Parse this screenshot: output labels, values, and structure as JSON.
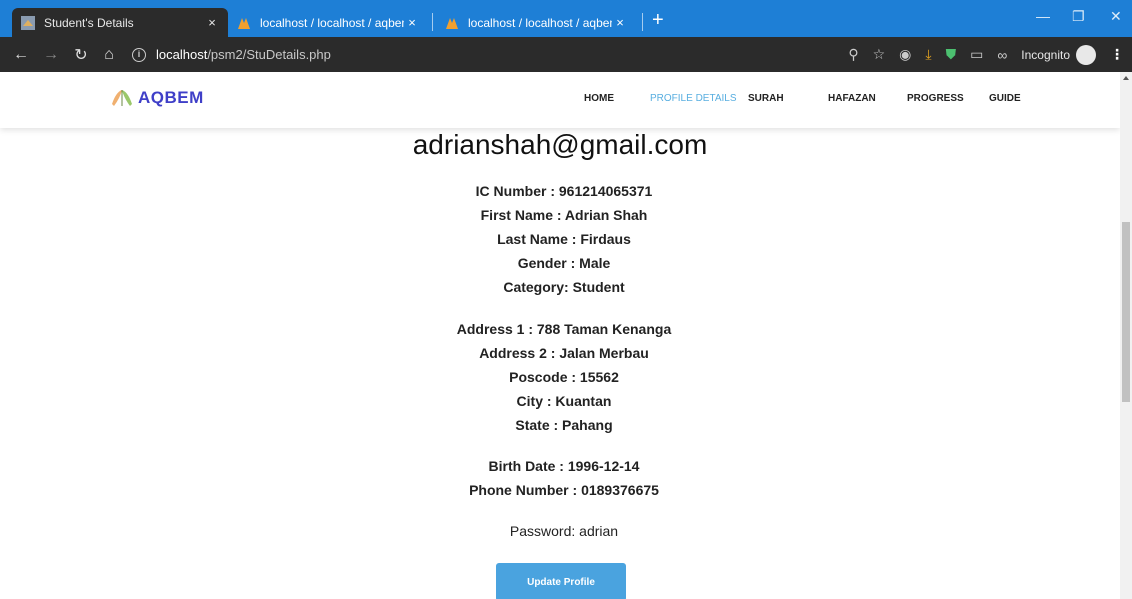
{
  "browser": {
    "tabs": [
      {
        "title": "Student's Details",
        "close": "×"
      },
      {
        "title": "localhost / localhost / aqbem / st",
        "close": "×"
      },
      {
        "title": "localhost / localhost / aqbem / st",
        "close": "×"
      }
    ],
    "new_tab": "+",
    "window_controls": {
      "minimize": "—",
      "restore": "❐",
      "close": "✕"
    },
    "url_host": "localhost",
    "url_path": "/psm2/StuDetails.php",
    "incognito_label": "Incognito"
  },
  "site": {
    "logo_text": "AQBEM",
    "nav": [
      "HOME",
      "PROFILE DETAILS",
      "SURAH",
      "HAFAZAN",
      "PROGRESS",
      "GUIDE"
    ]
  },
  "profile": {
    "email": "adrianshah@gmail.com",
    "ic": "IC Number : 961214065371",
    "first_name": "First Name : Adrian Shah",
    "last_name": "Last Name : Firdaus",
    "gender": "Gender : Male",
    "category": "Category: Student",
    "address1": "Address 1 : 788 Taman Kenanga",
    "address2": "Address 2 : Jalan Merbau",
    "poscode": "Poscode : 15562",
    "city": "City : Kuantan",
    "state": "State : Pahang",
    "birth_date": "Birth Date : 1996-12-14",
    "phone": "Phone Number : 0189376675",
    "password": "Password: adrian",
    "update_button": "Update Profile"
  },
  "colors": {
    "accent": "#4aa3df",
    "active_nav": "#58aee0",
    "tabbar": "#1e7fd6",
    "logo": "#3f3fc8"
  }
}
